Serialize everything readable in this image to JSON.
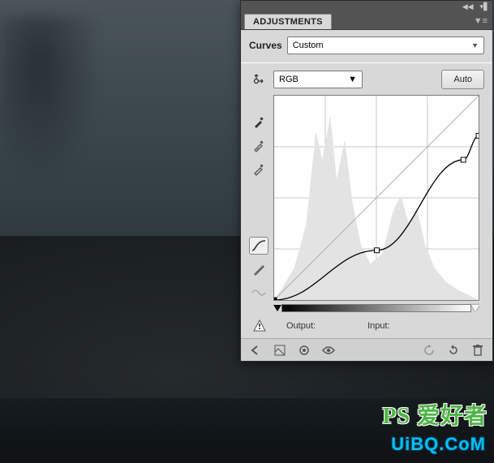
{
  "panel": {
    "tab_label": "ADJUSTMENTS",
    "adjustment_label": "Curves",
    "preset_value": "Custom",
    "channel_value": "RGB",
    "auto_label": "Auto",
    "output_label": "Output:",
    "input_label": "Input:"
  },
  "chart_data": {
    "type": "line",
    "title": "Curves",
    "xlabel": "Input",
    "ylabel": "Output",
    "xlim": [
      0,
      255
    ],
    "ylim": [
      0,
      255
    ],
    "grid": true,
    "series": [
      {
        "name": "baseline",
        "x": [
          0,
          255
        ],
        "y": [
          0,
          255
        ]
      },
      {
        "name": "curve",
        "points": [
          {
            "x": 0,
            "y": 0
          },
          {
            "x": 128,
            "y": 62
          },
          {
            "x": 236,
            "y": 175
          },
          {
            "x": 255,
            "y": 205
          }
        ]
      }
    ],
    "histogram_approx": [
      {
        "x": 10,
        "y": 15
      },
      {
        "x": 25,
        "y": 40
      },
      {
        "x": 40,
        "y": 95
      },
      {
        "x": 52,
        "y": 210
      },
      {
        "x": 60,
        "y": 175
      },
      {
        "x": 70,
        "y": 230
      },
      {
        "x": 78,
        "y": 150
      },
      {
        "x": 88,
        "y": 200
      },
      {
        "x": 98,
        "y": 120
      },
      {
        "x": 108,
        "y": 70
      },
      {
        "x": 120,
        "y": 45
      },
      {
        "x": 135,
        "y": 58
      },
      {
        "x": 148,
        "y": 110
      },
      {
        "x": 158,
        "y": 130
      },
      {
        "x": 168,
        "y": 95
      },
      {
        "x": 178,
        "y": 115
      },
      {
        "x": 188,
        "y": 70
      },
      {
        "x": 200,
        "y": 40
      },
      {
        "x": 215,
        "y": 22
      },
      {
        "x": 230,
        "y": 12
      },
      {
        "x": 245,
        "y": 5
      }
    ]
  },
  "watermarks": {
    "wm1": "PS 爱好者",
    "wm2": "UiBQ.CoM"
  }
}
